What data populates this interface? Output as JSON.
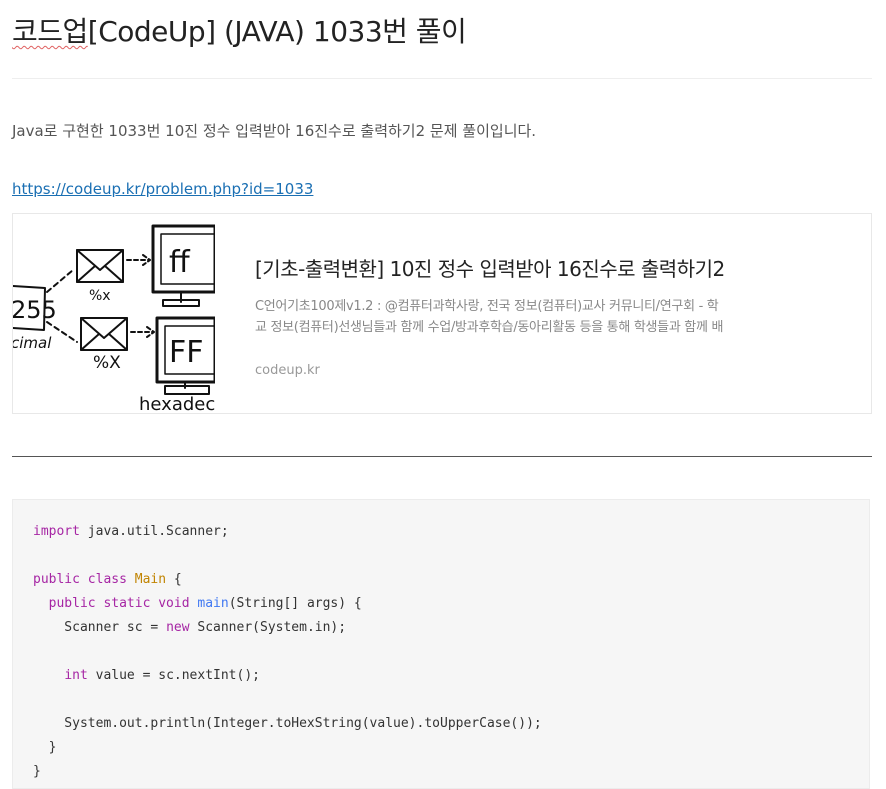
{
  "post": {
    "title_prefix": "코드업",
    "title_rest": "[CodeUp] (JAVA) 1033번 풀이",
    "intro": "Java로 구현한 1033번 10진 정수 입력받아 16진수로 출력하기2 문제 풀이입니다.",
    "link": "https://codeup.kr/problem.php?id=1033"
  },
  "card": {
    "title": "[기초-출력변환] 10진 정수 입력받아 16진수로 출력하기2",
    "description": "C언어기초100제v1.2 : @컴퓨터과학사랑, 전국 정보(컴퓨터)교사 커뮤니티/연구회 - 학교 정보(컴퓨터)선생님들과 함께 수업/방과후학습/동아리활동 등을 통해 학생들과 함께 배우는 즐거움을 나누고 있습니다.",
    "domain": "codeup.kr",
    "thumbnail": {
      "label_decimal_value": "255",
      "label_decimal": "cimal",
      "label_hex_lower": "ff",
      "label_hex_upper": "FF",
      "format_lower": "%x",
      "format_upper": "%X",
      "label_hexadecimal": "hexadeci"
    }
  },
  "code": {
    "lines": [
      [
        {
          "t": "import",
          "c": "kw"
        },
        {
          "t": " java.util.Scanner;"
        }
      ],
      [],
      [
        {
          "t": "public class",
          "c": "kw"
        },
        {
          "t": " "
        },
        {
          "t": "Main",
          "c": "cls"
        },
        {
          "t": " {"
        }
      ],
      [
        {
          "t": "  "
        },
        {
          "t": "public static void",
          "c": "kw"
        },
        {
          "t": " "
        },
        {
          "t": "main",
          "c": "fn"
        },
        {
          "t": "(String[] args) {"
        }
      ],
      [
        {
          "t": "    Scanner sc = "
        },
        {
          "t": "new",
          "c": "kw"
        },
        {
          "t": " Scanner(System.in);"
        }
      ],
      [],
      [
        {
          "t": "    "
        },
        {
          "t": "int",
          "c": "kw"
        },
        {
          "t": " value = sc.nextInt();"
        }
      ],
      [],
      [
        {
          "t": "    System.out.println(Integer.toHexString(value).toUpperCase());"
        }
      ],
      [
        {
          "t": "  }"
        }
      ],
      [
        {
          "t": "}"
        }
      ]
    ]
  }
}
